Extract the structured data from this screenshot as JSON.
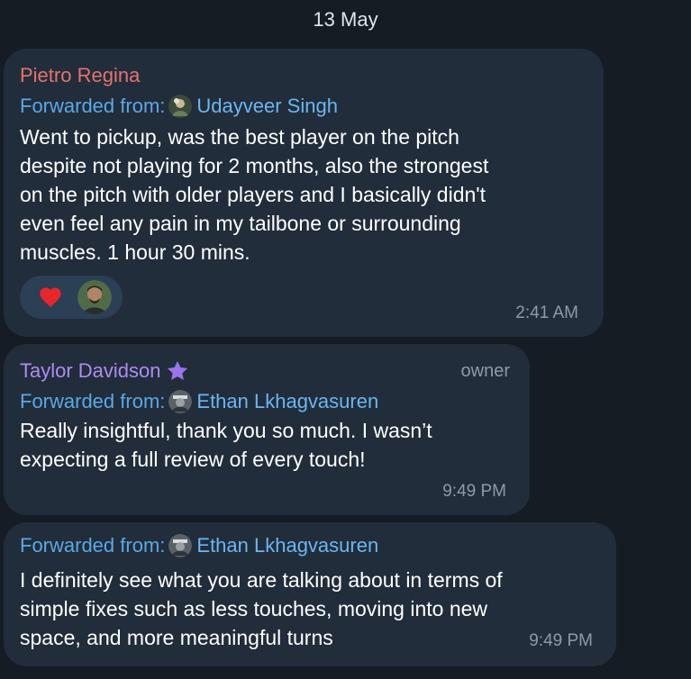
{
  "date_separator": "13 May",
  "messages": [
    {
      "sender": "Pietro Regina",
      "forwarded_prefix": "Forwarded from:",
      "forwarded_name": "Udayveer Singh",
      "text": "Went to pickup, was the best player on the pitch\ndespite not playing for 2 months, also the strongest\non the pitch with older players and I basically didn't\neven feel any pain in my tailbone or surrounding\nmuscles. 1 hour 30 mins.",
      "reaction_icon": "heart-icon",
      "time": "2:41 AM",
      "sender_color": "#e5736b"
    },
    {
      "sender": "Taylor Davidson",
      "sender_badge_icon": "star-icon",
      "role": "owner",
      "forwarded_prefix": "Forwarded from:",
      "forwarded_name": "Ethan Lkhagvasuren",
      "text": "Really insightful, thank you so much. I wasn’t\nexpecting a full review of every touch!",
      "time": "9:49 PM",
      "sender_color": "#ad8cf2"
    },
    {
      "forwarded_prefix": "Forwarded from:",
      "forwarded_name": "Ethan Lkhagvasuren",
      "text": "I definitely see what you are talking about in terms of\nsimple fixes such as less touches, moving into new\nspace, and more meaningful turns",
      "time": "9:49 PM"
    }
  ],
  "colors": {
    "background": "#151c24",
    "bubble": "#212d3b",
    "link": "#5ba8e6",
    "meta": "#8d9aa8"
  }
}
